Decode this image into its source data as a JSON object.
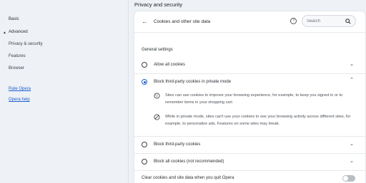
{
  "sidebar": {
    "basic": "Basic",
    "advanced": "Advanced",
    "advanced_caret": "▲",
    "privacy": "Privacy & security",
    "features": "Features",
    "browser": "Browser",
    "rate": "Rate Opera",
    "help": "Opera help"
  },
  "section_title": "Privacy and security",
  "card": {
    "back_icon": "arrow-left-icon",
    "title": "Cookies and other site data",
    "help_icon": "question-circle-icon",
    "search_placeholder": "Search",
    "general_settings": "General settings",
    "options": [
      {
        "label": "Allow all cookies",
        "selected": false
      },
      {
        "label": "Block third-party cookies in private mode",
        "selected": true
      },
      {
        "label": "Block third-party cookies",
        "selected": false
      },
      {
        "label": "Block all cookies (not recommended)",
        "selected": false
      }
    ],
    "details": [
      {
        "icon": "cookie-icon",
        "text": "Sites can use cookies to improve your browsing experience, for example, to keep you signed in or to remember items in your shopping cart"
      },
      {
        "icon": "block-icon",
        "text": "While in private mode, sites can't use your cookies to see your browsing activity across different sites, for example, to personalize ads. Features on some sites may break."
      }
    ],
    "clear_on_quit": {
      "label": "Clear cookies and site data when you quit Opera",
      "enabled": false
    }
  },
  "colors": {
    "accent": "#1a5fd0",
    "background": "#eef1f5",
    "card": "#ffffff"
  }
}
